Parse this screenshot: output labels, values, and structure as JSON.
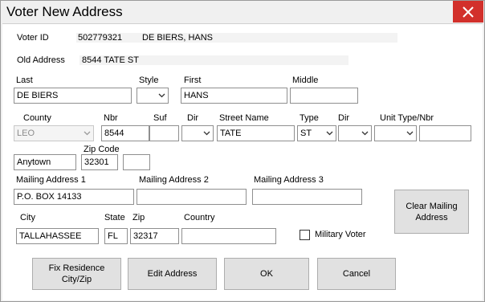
{
  "window": {
    "title": "Voter New Address"
  },
  "voter": {
    "id_label": "Voter ID",
    "id_value": "502779321",
    "name_value": "DE BIERS, HANS",
    "old_address_label": "Old Address",
    "old_address_value": "8544 TATE ST"
  },
  "name_row": {
    "last_label": "Last",
    "last_value": "DE BIERS",
    "style_label": "Style",
    "style_value": "",
    "first_label": "First",
    "first_value": "HANS",
    "middle_label": "Middle",
    "middle_value": ""
  },
  "address_row": {
    "county_label": "County",
    "county_value": "LEO",
    "nbr_label": "Nbr",
    "nbr_value": "8544",
    "suf_label": "Suf",
    "suf_value": "",
    "dir_label": "Dir",
    "dir_value": "",
    "street_label": "Street Name",
    "street_value": "TATE",
    "type_label": "Type",
    "type_value": "ST",
    "dir2_label": "Dir",
    "dir2_value": "",
    "unit_label": "Unit Type/Nbr",
    "unit_type_value": "",
    "unit_nbr_value": ""
  },
  "city_row": {
    "city_value": "Anytown",
    "zip_label": "Zip Code",
    "zip_value": "32301",
    "zip_ext_value": ""
  },
  "mailing": {
    "addr1_label": "Mailing Address 1",
    "addr1_value": "P.O. BOX 14133",
    "addr2_label": "Mailing Address 2",
    "addr2_value": "",
    "addr3_label": "Mailing Address 3",
    "addr3_value": "",
    "clear_button": "Clear Mailing Address",
    "city_label": "City",
    "city_value": "TALLAHASSEE",
    "state_label": "State",
    "state_value": "FL",
    "zip_label": "Zip",
    "zip_value": "32317",
    "country_label": "Country",
    "country_value": "",
    "military_label": "Military Voter",
    "military_checked": false
  },
  "buttons": {
    "fix_residence": "Fix Residence City/Zip",
    "edit_address": "Edit Address",
    "ok": "OK",
    "cancel": "Cancel"
  },
  "icons": {
    "close": "close-icon",
    "dropdown": "chevron-down-icon",
    "checkbox": "checkbox-icon"
  },
  "colors": {
    "close_button": "#d2302b"
  }
}
